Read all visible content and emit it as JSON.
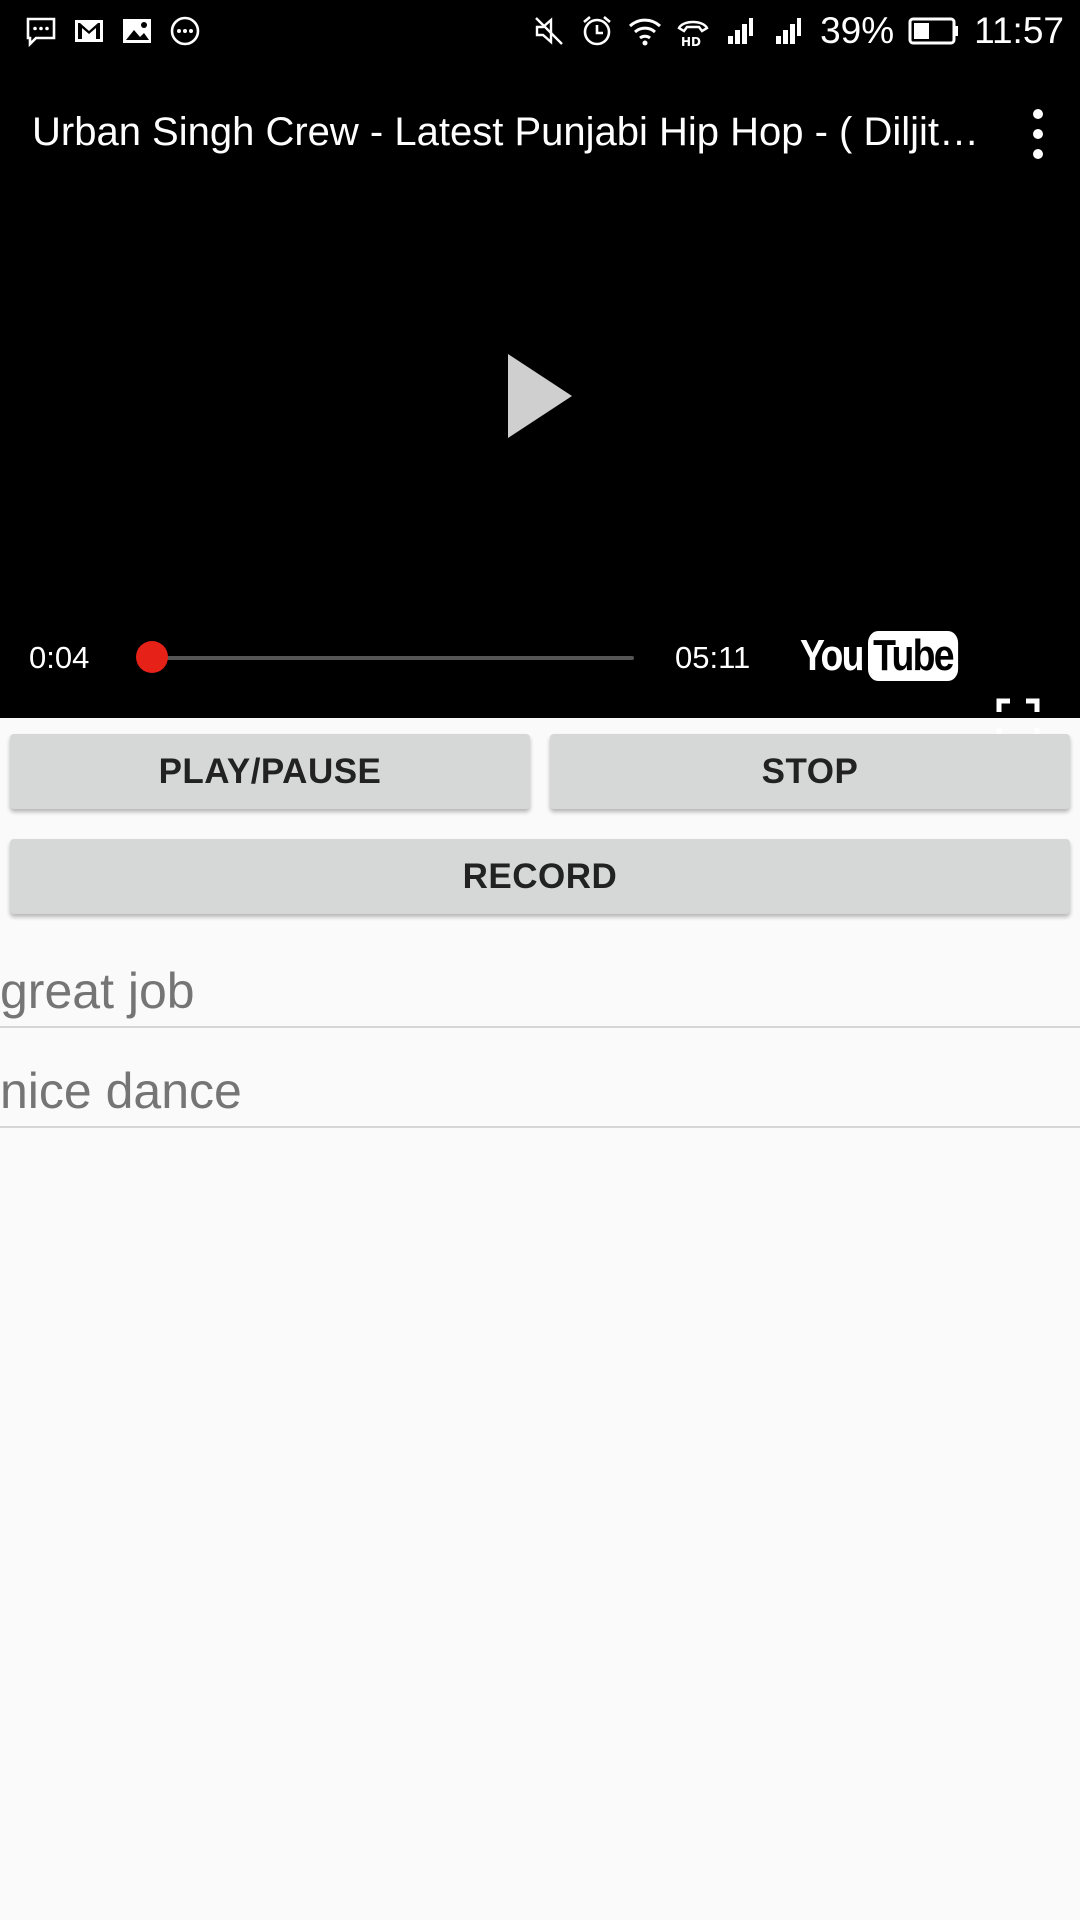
{
  "status_bar": {
    "battery_percent": "39%",
    "time": "11:57",
    "left_icons": [
      "message-icon",
      "gmail-icon",
      "gallery-icon",
      "more-dots-icon"
    ],
    "right_icons": [
      "mute-icon",
      "alarm-icon",
      "wifi-icon",
      "hd-call-icon",
      "signal-icon",
      "signal-icon",
      "battery-icon"
    ]
  },
  "player": {
    "title": "Urban Singh Crew - Latest Punjabi Hip Hop - ( Diljit ,...",
    "current_time": "0:04",
    "total_time": "05:11",
    "progress_fraction": 0.013,
    "logo_you": "You",
    "logo_tube": "Tube",
    "accent_color": "#e62117"
  },
  "controls": {
    "play_pause_label": "PLAY/PAUSE",
    "stop_label": "STOP",
    "record_label": "RECORD"
  },
  "comments": [
    "great job",
    "nice dance"
  ]
}
